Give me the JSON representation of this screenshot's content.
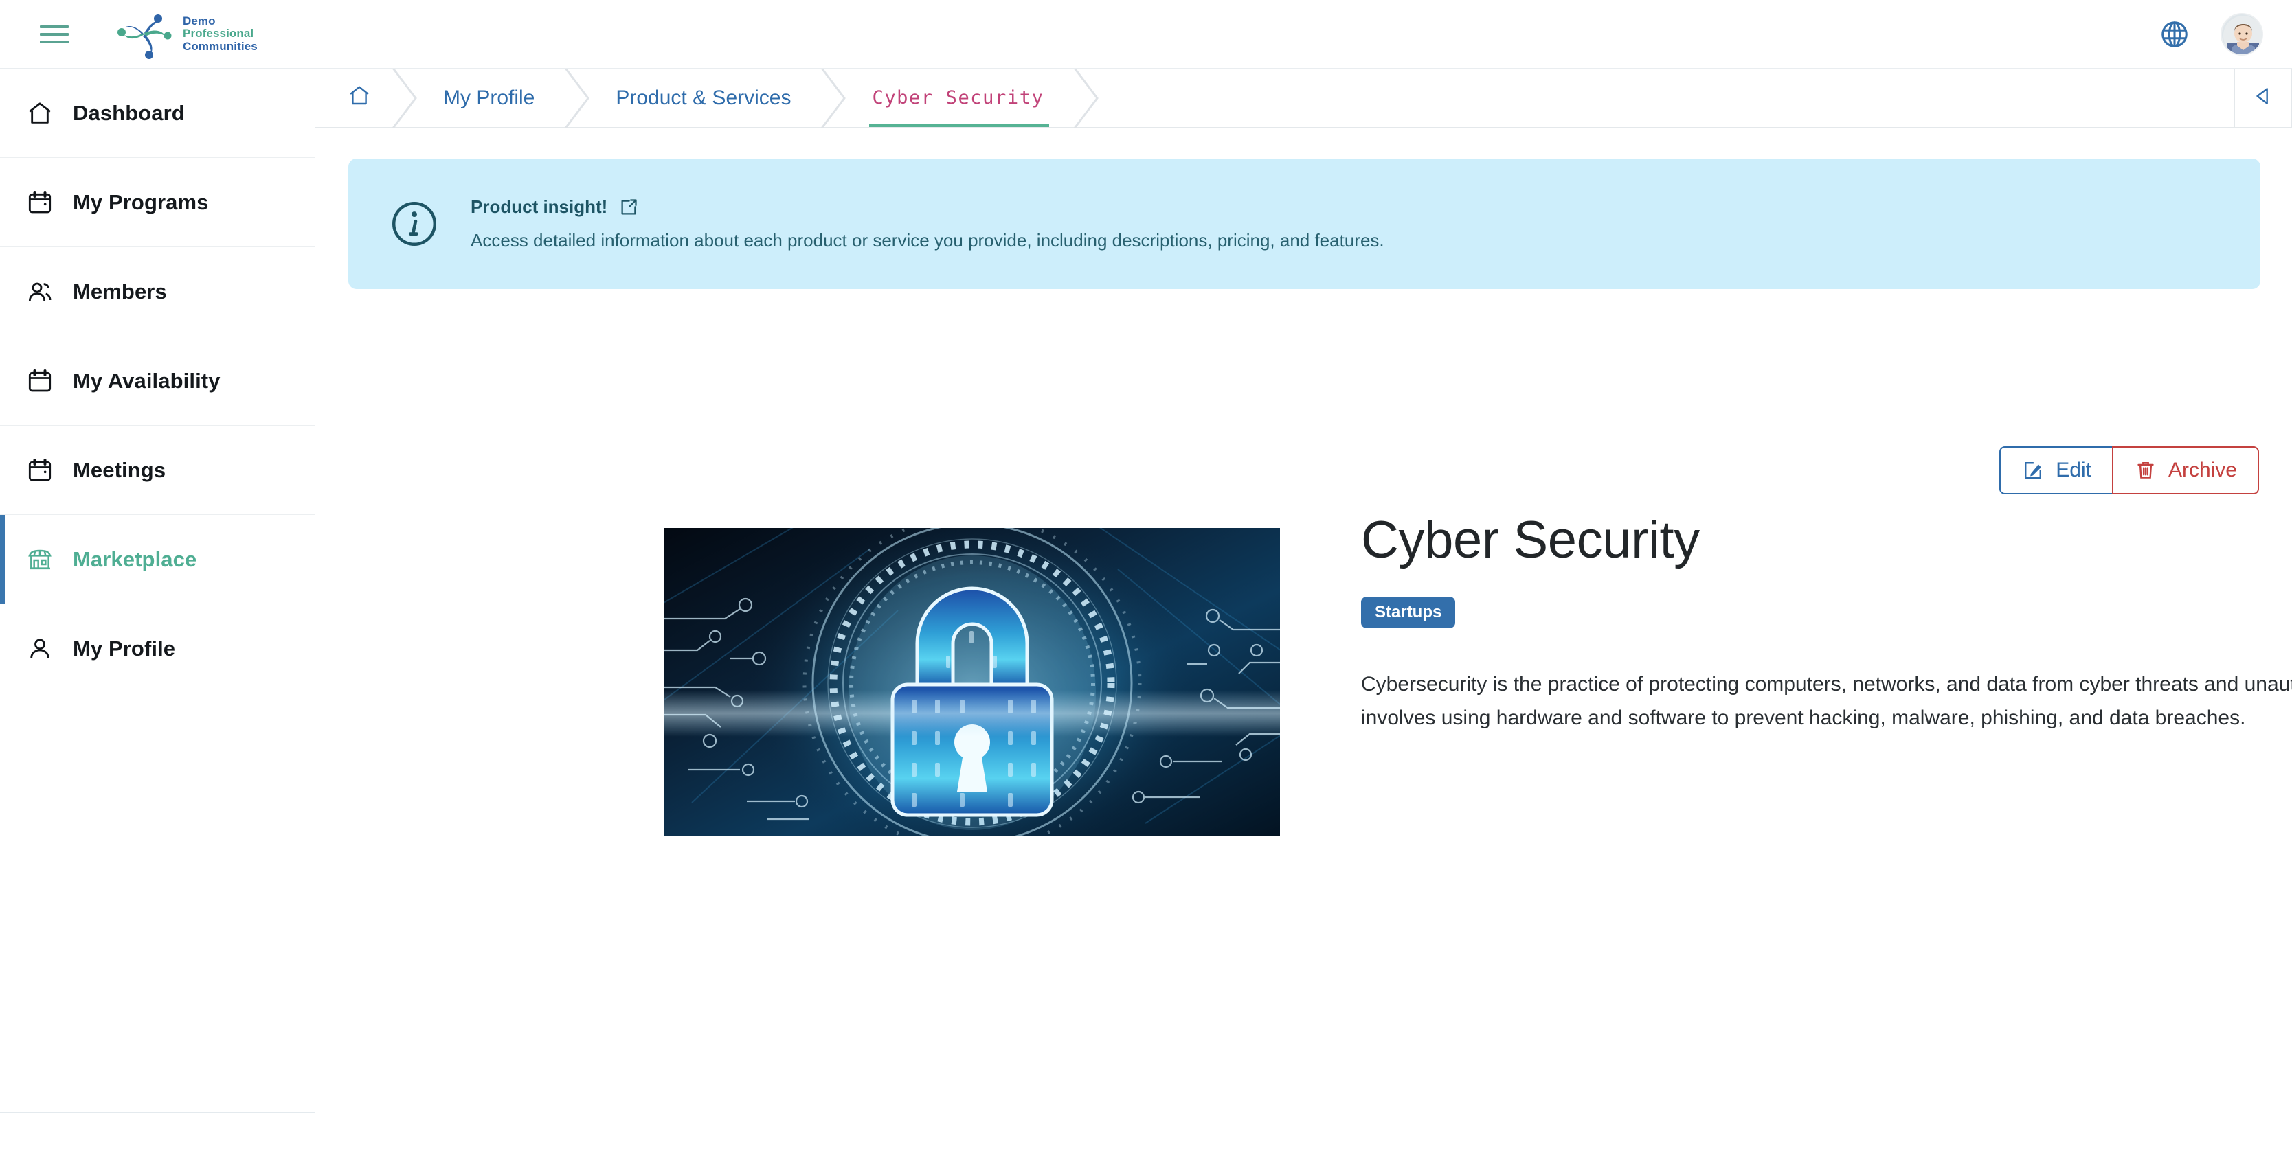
{
  "header": {
    "menu_icon": "hamburger-icon",
    "brand": {
      "line1": "Demo",
      "line2": "Professional",
      "line3": "Communities",
      "logo_icon": "pinwheel-people-logo"
    },
    "language_icon": "globe-icon",
    "avatar_icon": "user-avatar"
  },
  "sidebar": {
    "items": [
      {
        "label": "Dashboard",
        "icon": "home-icon",
        "active": false
      },
      {
        "label": "My Programs",
        "icon": "calendar-icon",
        "active": false
      },
      {
        "label": "Members",
        "icon": "users-icon",
        "active": false
      },
      {
        "label": "My Availability",
        "icon": "calendar-icon",
        "active": false
      },
      {
        "label": "Meetings",
        "icon": "calendar-icon",
        "active": false
      },
      {
        "label": "Marketplace",
        "icon": "storefront-icon",
        "active": true
      },
      {
        "label": "My Profile",
        "icon": "user-icon",
        "active": false
      }
    ]
  },
  "breadcrumb": {
    "home_icon": "home-icon",
    "items": [
      {
        "label": "My Profile",
        "current": false
      },
      {
        "label": "Product & Services",
        "current": false
      },
      {
        "label": "Cyber Security",
        "current": true
      }
    ],
    "collapse_icon": "triangle-left-icon"
  },
  "banner": {
    "icon": "info-circle-icon",
    "title": "Product insight!",
    "link_icon": "external-link-icon",
    "text": "Access detailed information about each product or service you provide, including descriptions, pricing, and features."
  },
  "actions": {
    "edit_label": "Edit",
    "edit_icon": "pencil-square-icon",
    "archive_label": "Archive",
    "archive_icon": "trash-icon"
  },
  "product": {
    "image_icon": "padlock-cyber-image",
    "title": "Cyber Security",
    "tag": "Startups",
    "description": "Cybersecurity is the practice of protecting computers, networks, and data from cyber threats and unauthorized access. It involves using hardware and software to prevent hacking, malware, phishing, and data breaches."
  },
  "colors": {
    "accent_blue": "#336fab",
    "accent_green": "#4fae93",
    "current_crumb": "#c14278",
    "banner_bg": "#cdeefb",
    "danger_red": "#c4413f"
  }
}
